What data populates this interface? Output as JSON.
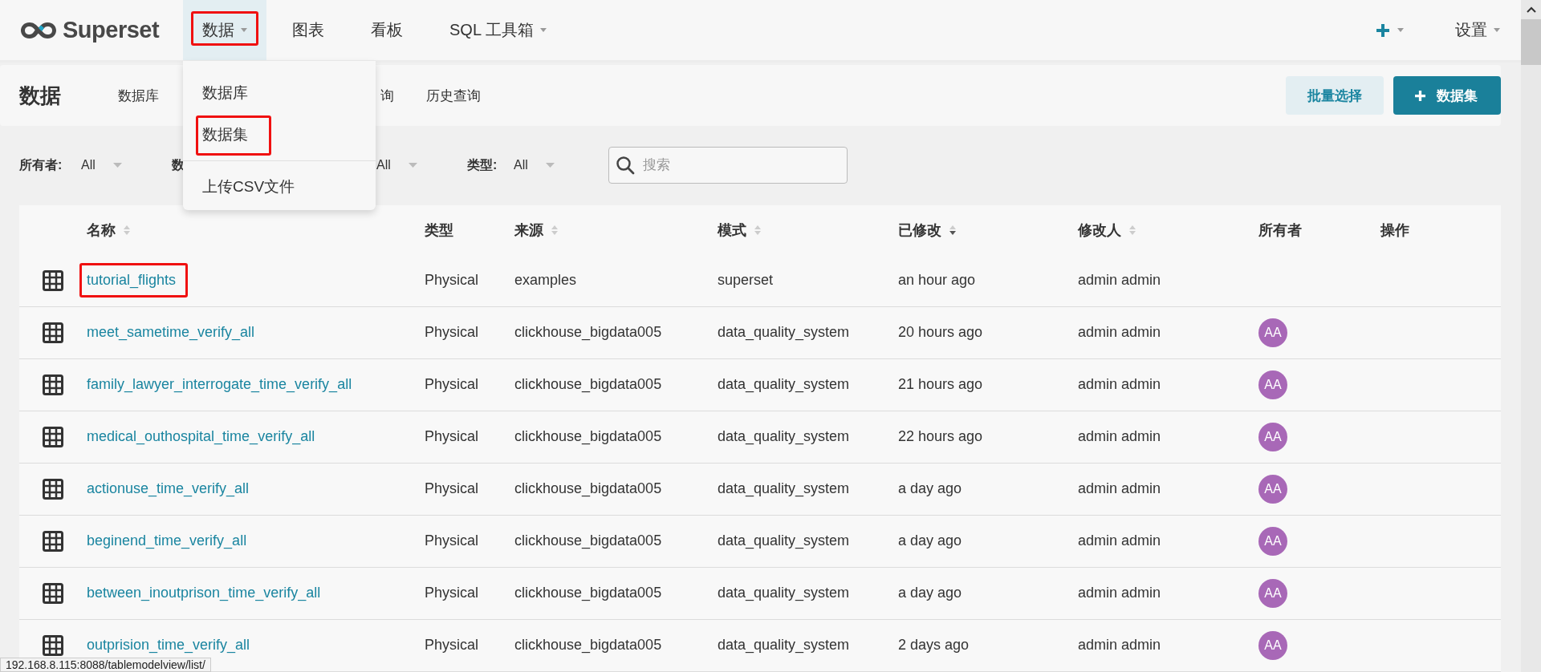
{
  "brand": {
    "name": "Superset"
  },
  "nav": [
    {
      "label": "数据",
      "selected": true,
      "caret": true,
      "highlighted": true
    },
    {
      "label": "图表",
      "selected": false,
      "caret": false,
      "highlighted": false
    },
    {
      "label": "看板",
      "selected": false,
      "caret": false,
      "highlighted": false
    },
    {
      "label": "SQL 工具箱",
      "selected": false,
      "caret": true,
      "highlighted": false
    }
  ],
  "nav_right": [
    {
      "kind": "plus"
    },
    {
      "kind": "menu",
      "label": "设置"
    }
  ],
  "dropdown": {
    "items": [
      {
        "label": "数据库",
        "highlighted": false,
        "divider_before": false
      },
      {
        "label": "数据集",
        "highlighted": true,
        "divider_before": false
      },
      {
        "label": "上传CSV文件",
        "highlighted": false,
        "divider_before": true
      }
    ]
  },
  "subheader": {
    "title": "数据",
    "tabs": [
      {
        "label": "数据库"
      },
      {
        "label": "询"
      },
      {
        "label": "历史查询"
      }
    ],
    "buttons": [
      {
        "label": "批量选择",
        "kind": "secondary"
      },
      {
        "label": "数据集",
        "kind": "primary"
      }
    ]
  },
  "filters": [
    {
      "label": "所有者:",
      "value": "All"
    },
    {
      "label": "数",
      "value": "All"
    },
    {
      "label": "类型:",
      "value": "All"
    }
  ],
  "search": {
    "placeholder": "搜索"
  },
  "table": {
    "columns": [
      {
        "label": "名称",
        "sorted": false
      },
      {
        "label": "类型"
      },
      {
        "label": "来源",
        "sorted": false
      },
      {
        "label": "模式",
        "sorted": false
      },
      {
        "label": "已修改",
        "sorted": true
      },
      {
        "label": "修改人",
        "sorted": false
      },
      {
        "label": "所有者"
      },
      {
        "label": "操作"
      }
    ],
    "rows": [
      {
        "name": "tutorial_flights",
        "highlighted": true,
        "type": "Physical",
        "source": "examples",
        "schema": "superset",
        "modified": "an hour ago",
        "modified_by": "admin admin"
      },
      {
        "name": "meet_sametime_verify_all",
        "highlighted": false,
        "type": "Physical",
        "source": "clickhouse_bigdata005",
        "schema": "data_quality_system",
        "modified": "20 hours ago",
        "modified_by": "admin admin",
        "owner": "AA"
      },
      {
        "name": "family_lawyer_interrogate_time_verify_all",
        "highlighted": false,
        "type": "Physical",
        "source": "clickhouse_bigdata005",
        "schema": "data_quality_system",
        "modified": "21 hours ago",
        "modified_by": "admin admin",
        "owner": "AA"
      },
      {
        "name": "medical_outhospital_time_verify_all",
        "highlighted": false,
        "type": "Physical",
        "source": "clickhouse_bigdata005",
        "schema": "data_quality_system",
        "modified": "22 hours ago",
        "modified_by": "admin admin",
        "owner": "AA"
      },
      {
        "name": "actionuse_time_verify_all",
        "highlighted": false,
        "type": "Physical",
        "source": "clickhouse_bigdata005",
        "schema": "data_quality_system",
        "modified": "a day ago",
        "modified_by": "admin admin",
        "owner": "AA"
      },
      {
        "name": "beginend_time_verify_all",
        "highlighted": false,
        "type": "Physical",
        "source": "clickhouse_bigdata005",
        "schema": "data_quality_system",
        "modified": "a day ago",
        "modified_by": "admin admin",
        "owner": "AA"
      },
      {
        "name": "between_inoutprison_time_verify_all",
        "highlighted": false,
        "type": "Physical",
        "source": "clickhouse_bigdata005",
        "schema": "data_quality_system",
        "modified": "a day ago",
        "modified_by": "admin admin",
        "owner": "AA"
      },
      {
        "name": "outprision_time_verify_all",
        "highlighted": false,
        "type": "Physical",
        "source": "clickhouse_bigdata005",
        "schema": "data_quality_system",
        "modified": "2 days ago",
        "modified_by": "admin admin",
        "owner": "AA"
      }
    ]
  },
  "status_bar": {
    "url": "192.168.8.115:8088/tablemodelview/list/"
  }
}
